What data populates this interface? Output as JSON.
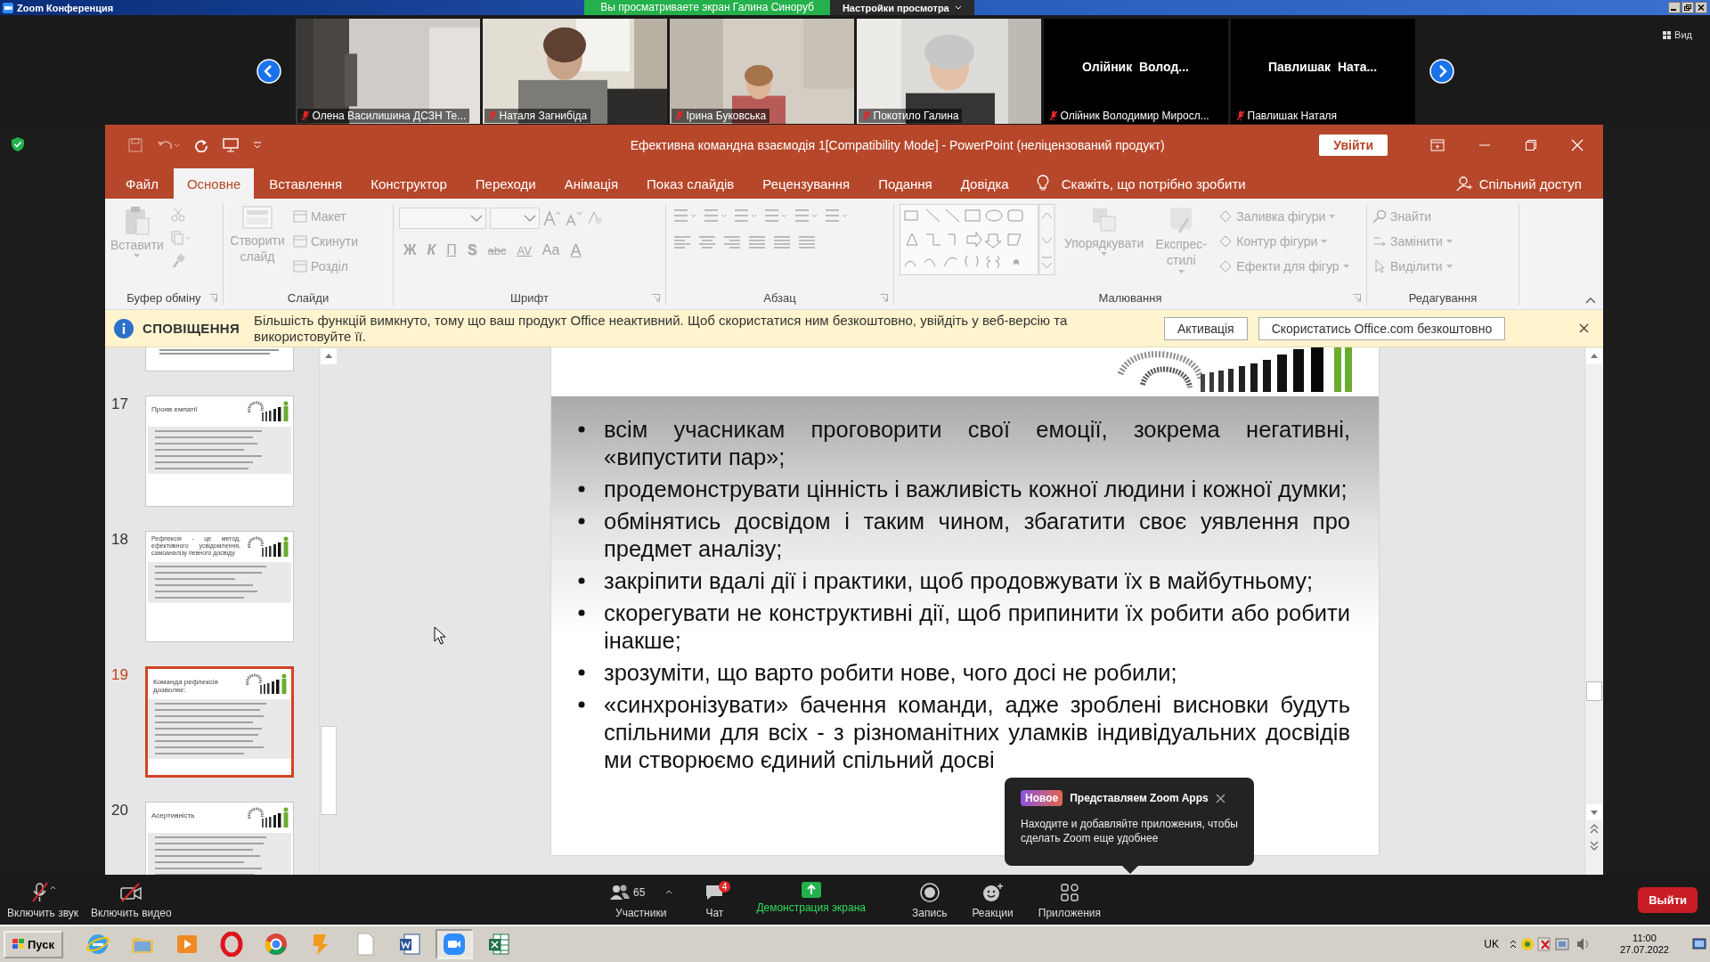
{
  "zoom_window": {
    "title": "Zoom Конференция",
    "share_banner": "Вы просматриваете экран Галина Синоруб",
    "view_options": "Настройки просмотра",
    "view_button": "Вид"
  },
  "participants": [
    {
      "kind": "video",
      "name": "Олена Василишина ДСЗН Те...",
      "muted": true
    },
    {
      "kind": "video",
      "name": "Наталя Загнибіда",
      "muted": true
    },
    {
      "kind": "video",
      "name": "Ірина Буковська",
      "muted": true
    },
    {
      "kind": "video",
      "name": "Покотило Галина",
      "muted": true
    },
    {
      "kind": "name",
      "display_name": "Олійник  Волод...",
      "name": "Олійник Володимир Миросл...",
      "muted": true
    },
    {
      "kind": "name",
      "display_name": "Павлишак  Ната...",
      "name": "Павлишак Наталя",
      "muted": true
    }
  ],
  "powerpoint": {
    "title": "Ефективна командна взаємодія 1[Compatibility Mode]  -  PowerPoint (неліцензований продукт)",
    "sign_in": "Увійти",
    "tabs": [
      {
        "label": "Файл",
        "selected": false
      },
      {
        "label": "Основне",
        "selected": true
      },
      {
        "label": "Вставлення",
        "selected": false
      },
      {
        "label": "Конструктор",
        "selected": false
      },
      {
        "label": "Переходи",
        "selected": false
      },
      {
        "label": "Анімація",
        "selected": false
      },
      {
        "label": "Показ слайдів",
        "selected": false
      },
      {
        "label": "Рецензування",
        "selected": false
      },
      {
        "label": "Подання",
        "selected": false
      },
      {
        "label": "Довідка",
        "selected": false
      }
    ],
    "tell_me": "Скажіть, що потрібно зробити",
    "share": "Спільний доступ",
    "ribbon_groups": [
      {
        "kind": "clipboard",
        "label": "Буфер обміну",
        "commands": [
          {
            "label": "Вставити",
            "disabled": true
          }
        ]
      },
      {
        "kind": "slides",
        "label": "Слайди",
        "commands": [
          {
            "label": "Створити слайд",
            "disabled": true
          },
          {
            "label": "Макет",
            "disabled": true
          },
          {
            "label": "Скинути",
            "disabled": true
          },
          {
            "label": "Розділ",
            "disabled": true
          }
        ]
      },
      {
        "kind": "font",
        "label": "Шрифт",
        "commands": [
          {
            "label": "Ж",
            "disabled": true
          },
          {
            "label": "К",
            "disabled": true
          },
          {
            "label": "П",
            "disabled": true
          },
          {
            "label": "S",
            "disabled": true
          },
          {
            "label": "abc",
            "disabled": true
          },
          {
            "label": "AV",
            "disabled": true
          },
          {
            "label": "Aa",
            "disabled": true
          },
          {
            "label": "A",
            "disabled": true
          }
        ]
      },
      {
        "kind": "paragraph",
        "label": "Абзац"
      },
      {
        "kind": "drawing",
        "label": "Малювання",
        "commands": [
          {
            "label": "Упорядкувати",
            "disabled": true
          },
          {
            "label": "Експрес-стилі",
            "disabled": true
          },
          {
            "label": "Заливка фігури",
            "disabled": true
          },
          {
            "label": "Контур фігури",
            "disabled": true
          },
          {
            "label": "Ефекти для фігур",
            "disabled": true
          }
        ]
      },
      {
        "kind": "editing",
        "label": "Редагування",
        "commands": [
          {
            "label": "Знайти",
            "disabled": true
          },
          {
            "label": "Замінити",
            "disabled": true
          },
          {
            "label": "Виділити",
            "disabled": true
          }
        ]
      }
    ],
    "notification": {
      "title": "СПОВІЩЕННЯ",
      "message": "Більшість функцій вимкнуто, тому що ваш продукт Office неактивний. Щоб скористатися ним безкоштовно, увійдіть у веб-версію та використовуйте її.",
      "buttons": [
        "Активація",
        "Скористатись Office.com безкоштовно"
      ]
    },
    "thumbnails": [
      {
        "number": "17",
        "title": "Прояв емпатії",
        "selected": false
      },
      {
        "number": "18",
        "title": "Рефлексія - це метод, ефективного усвідомлення, самоаналізу певного досвіду",
        "selected": false
      },
      {
        "number": "19",
        "title": "Команда рефлексія дозволяє:",
        "selected": true
      },
      {
        "number": "20",
        "title": "Асертивність",
        "selected": false
      }
    ],
    "slide_bullets": [
      "всім учасникам проговорити свої емоції, зокрема негативні, «випустити пар»;",
      "продемонструвати цінність і важливість кожної людини і кожної думки;",
      "обмінятись досвідом і таким чином, збагатити своє уявлення про предмет аналізу;",
      "закріпити вдалі дії і практики, щоб продовжувати їх в майбутньому;",
      "скорегувати не конструктивні дії, щоб припинити їх робити або робити інакше;",
      "зрозуміти, що варто робити нове, чого досі не робили;",
      "«синхронізувати» бачення команди, адже зроблені висновки будуть спільними для всіх - з різноманітних уламків індивідуальних досвідів ми створюємо єдиний спільний досві"
    ]
  },
  "zoom_popup": {
    "badge": "Новое",
    "title": "Представляем Zoom Apps",
    "text": "Находите и добавляйте приложения, чтобы сделать Zoom еще удобнее"
  },
  "meeting_controls": {
    "left": [
      {
        "kind": "audio",
        "label": "Включить звук"
      },
      {
        "kind": "video",
        "label": "Включить видео"
      }
    ],
    "center": [
      {
        "kind": "participants",
        "label": "Участники",
        "count": "65"
      },
      {
        "kind": "chat",
        "label": "Чат",
        "badge": "4"
      },
      {
        "kind": "share",
        "label": "Демонстрация экрана"
      },
      {
        "kind": "record",
        "label": "Запись"
      },
      {
        "kind": "reactions",
        "label": "Реакции"
      },
      {
        "kind": "apps",
        "label": "Приложения"
      }
    ],
    "leave": "Выйти"
  },
  "taskbar": {
    "start": "Пуск",
    "apps": [
      {
        "kind": "globe",
        "selected": false
      },
      {
        "kind": "folder",
        "selected": false
      },
      {
        "kind": "player",
        "selected": false
      },
      {
        "kind": "ring",
        "selected": false
      },
      {
        "kind": "tricolor",
        "selected": false
      },
      {
        "kind": "app",
        "selected": false
      },
      {
        "kind": "page",
        "selected": false
      },
      {
        "kind": "doc",
        "selected": false
      },
      {
        "kind": "camera",
        "selected": true
      },
      {
        "kind": "sheet",
        "selected": false
      }
    ],
    "language": "UK",
    "time": "11:00",
    "date": "27.07.2022"
  }
}
